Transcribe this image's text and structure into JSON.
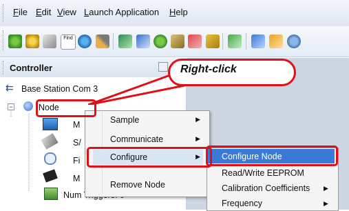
{
  "menu": {
    "items": [
      "File",
      "Edit",
      "View",
      "Launch Application",
      "Help"
    ]
  },
  "toolbar": {
    "icons": [
      "node-discovery-icon",
      "find-icon",
      "network-icon",
      "wrench-icon",
      "sweep-icon",
      "wand-icon",
      "nodes-icon",
      "radio-icon",
      "data-icon",
      "edit-icon",
      "signal-icon",
      "chart-icon",
      "flag-icon",
      "sync-icon"
    ]
  },
  "controller": {
    "title": "Controller",
    "tree": {
      "base_station": "Base Station Com 3",
      "node": "Node",
      "child1": "M",
      "child2": "S/",
      "child3": "Fi",
      "child4": "M",
      "child5": "Num Triggers: 0"
    }
  },
  "callout": {
    "text": "Right-click"
  },
  "context_menu": {
    "items": [
      {
        "label": "Sample",
        "submenu": true
      },
      {
        "label": "Communicate",
        "submenu": true
      },
      {
        "label": "Configure",
        "submenu": true
      },
      {
        "label": "Remove Node",
        "submenu": false
      }
    ]
  },
  "configure_submenu": {
    "items": [
      {
        "label": "Configure Node",
        "submenu": false,
        "selected": true
      },
      {
        "label": "Read/Write EEPROM",
        "submenu": false
      },
      {
        "label": "Calibration Coefficients",
        "submenu": true
      },
      {
        "label": "Frequency",
        "submenu": true
      }
    ]
  },
  "colors": {
    "annotation": "#e01018",
    "highlight": "#3a7ad6"
  }
}
